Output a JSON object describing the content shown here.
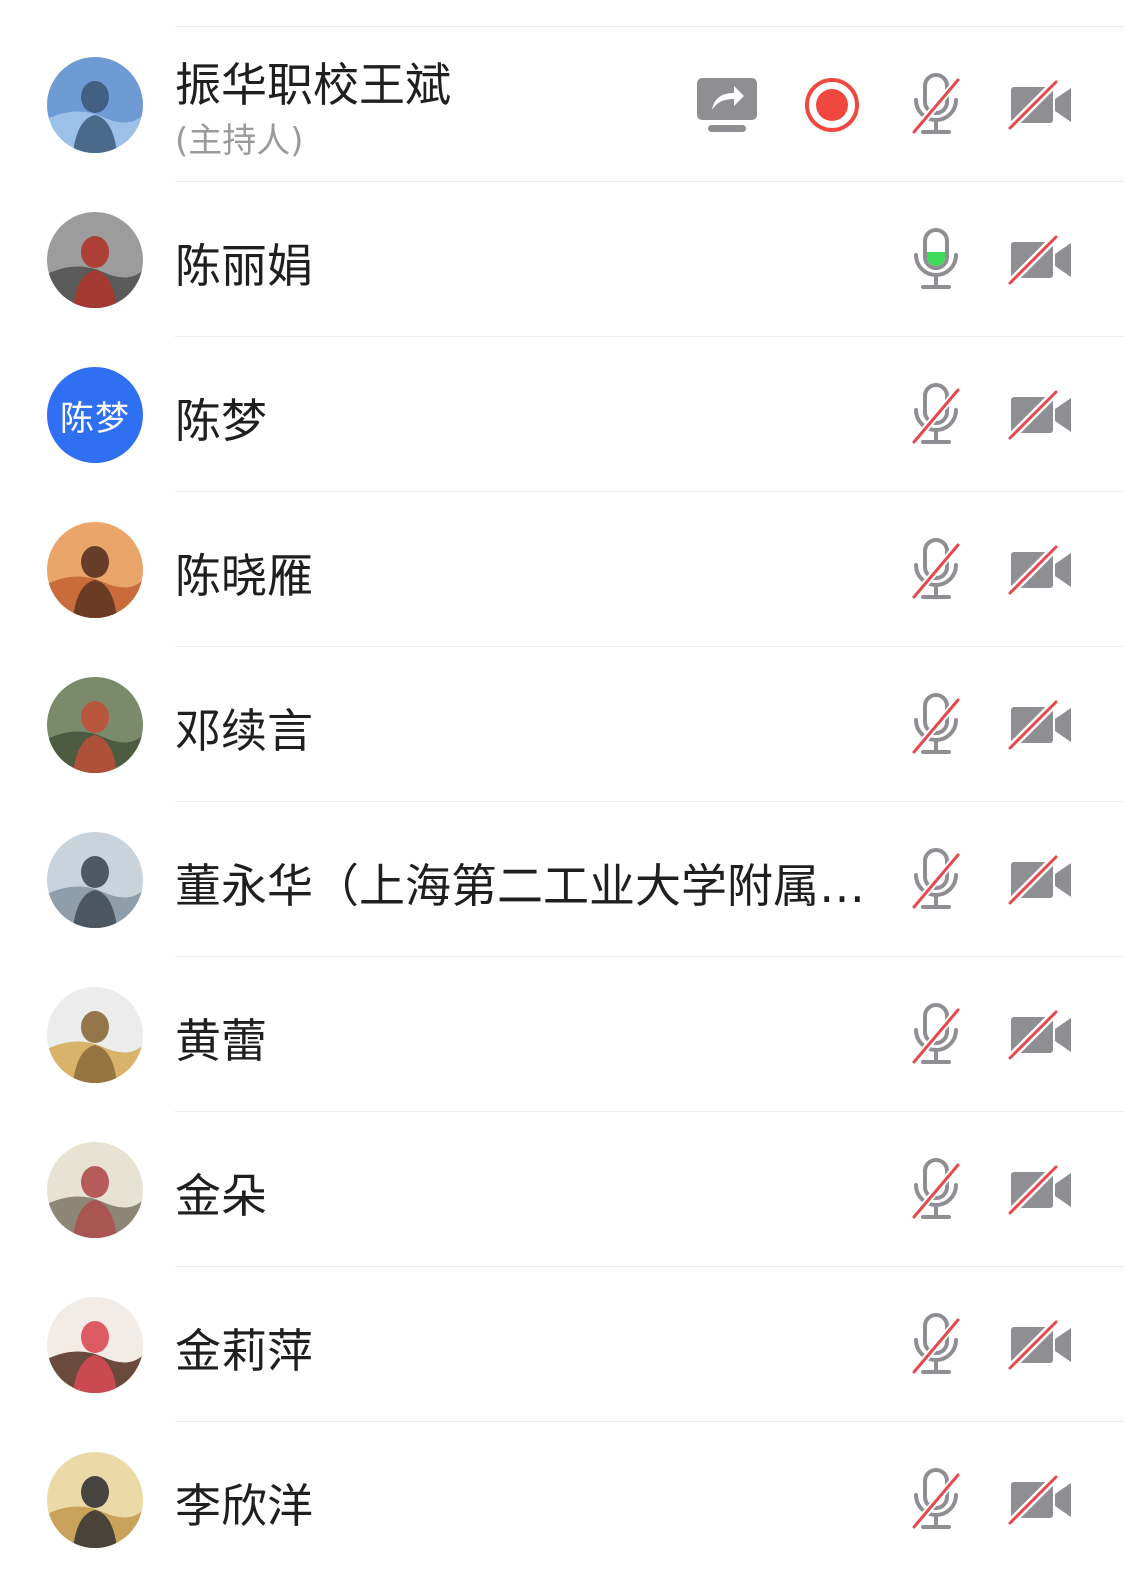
{
  "colors": {
    "accent_blue": "#2f6ff2",
    "mute_red": "#e5484d",
    "icon_gray": "#8e8e93",
    "speaking_green": "#3fdc57",
    "record_red": "#f0473f"
  },
  "participants": [
    {
      "name": "振华职校王斌",
      "role": "(主持人)",
      "avatar_type": "photo",
      "avatar_colors": [
        "#6f9bd4",
        "#9cc1e8",
        "#3c5a7a"
      ],
      "sharing": true,
      "recording": true,
      "mic": "muted",
      "camera": "off"
    },
    {
      "name": "陈丽娟",
      "avatar_type": "photo",
      "avatar_colors": [
        "#9c9c9c",
        "#5a5a5a",
        "#b0352c"
      ],
      "mic": "speaking",
      "camera": "off"
    },
    {
      "name": "陈梦",
      "avatar_type": "text",
      "avatar_text": "陈梦",
      "avatar_colors": [
        "#2f6ff2"
      ],
      "mic": "muted",
      "camera": "off"
    },
    {
      "name": "陈晓雁",
      "avatar_type": "photo",
      "avatar_colors": [
        "#e9a56a",
        "#c96b3b",
        "#5a3220"
      ],
      "mic": "muted",
      "camera": "off"
    },
    {
      "name": "邓续言",
      "avatar_type": "photo",
      "avatar_colors": [
        "#7a8a6a",
        "#4d5b40",
        "#c0503a"
      ],
      "mic": "muted",
      "camera": "off"
    },
    {
      "name": "董永华（上海第二工业大学附属…",
      "avatar_type": "photo",
      "avatar_colors": [
        "#c9d3dc",
        "#8f9eab",
        "#3f4a53"
      ],
      "mic": "muted",
      "camera": "off"
    },
    {
      "name": "黄蕾",
      "avatar_type": "photo",
      "avatar_colors": [
        "#ececec",
        "#d9b36a",
        "#8a6a3a"
      ],
      "mic": "muted",
      "camera": "off"
    },
    {
      "name": "金朵",
      "avatar_type": "photo",
      "avatar_colors": [
        "#e8e2d3",
        "#8d8677",
        "#b04c4c"
      ],
      "mic": "muted",
      "camera": "off"
    },
    {
      "name": "金莉萍",
      "avatar_type": "photo",
      "avatar_colors": [
        "#f3ece6",
        "#6a4a3c",
        "#d94b55"
      ],
      "mic": "muted",
      "camera": "off"
    },
    {
      "name": "李欣洋",
      "avatar_type": "photo",
      "avatar_colors": [
        "#ecd9a8",
        "#c9a35c",
        "#333333"
      ],
      "mic": "muted",
      "camera": "off"
    }
  ]
}
